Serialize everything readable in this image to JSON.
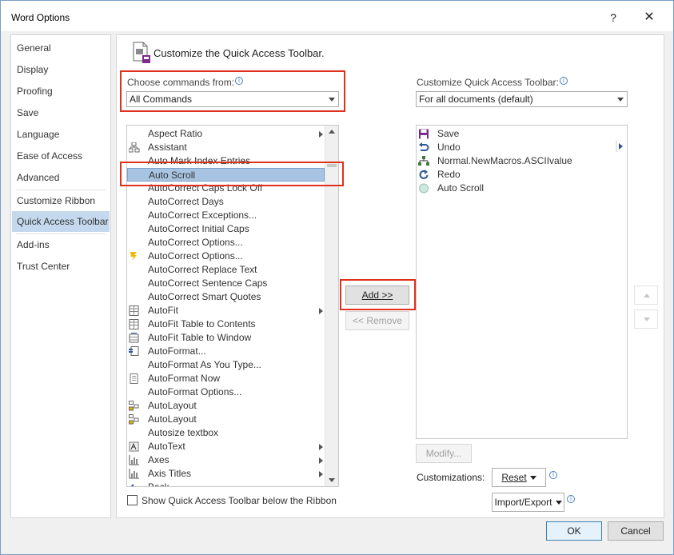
{
  "window": {
    "title": "Word Options",
    "help_label": "?",
    "close_label": "✕"
  },
  "nav": {
    "items": [
      {
        "label": "General"
      },
      {
        "label": "Display"
      },
      {
        "label": "Proofing"
      },
      {
        "label": "Save"
      },
      {
        "label": "Language"
      },
      {
        "label": "Ease of Access"
      },
      {
        "label": "Advanced"
      },
      {
        "label": "Customize Ribbon"
      },
      {
        "label": "Quick Access Toolbar"
      },
      {
        "label": "Add-ins"
      },
      {
        "label": "Trust Center"
      }
    ],
    "active": "Quick Access Toolbar"
  },
  "main": {
    "header": "Customize the Quick Access Toolbar.",
    "choose_label": "Choose commands from:",
    "choose_value": "All Commands",
    "customize_label": "Customize Quick Access Toolbar:",
    "customize_value": "For all documents (default)",
    "info_glyph": "i"
  },
  "commands": [
    {
      "label": "Aspect Ratio",
      "icon": "none",
      "submenu": true
    },
    {
      "label": "Assistant",
      "icon": "org-chart-icon",
      "submenu": false
    },
    {
      "label": "Auto Mark Index Entries",
      "icon": "none",
      "submenu": false
    },
    {
      "label": "Auto Scroll",
      "icon": "none",
      "submenu": false,
      "selected": true
    },
    {
      "label": "AutoCorrect Caps Lock Off",
      "icon": "none",
      "submenu": false
    },
    {
      "label": "AutoCorrect Days",
      "icon": "none",
      "submenu": false
    },
    {
      "label": "AutoCorrect Exceptions...",
      "icon": "none",
      "submenu": false
    },
    {
      "label": "AutoCorrect Initial Caps",
      "icon": "none",
      "submenu": false
    },
    {
      "label": "AutoCorrect Options...",
      "icon": "none",
      "submenu": false
    },
    {
      "label": "AutoCorrect Options...",
      "icon": "lightning-icon",
      "submenu": false
    },
    {
      "label": "AutoCorrect Replace Text",
      "icon": "none",
      "submenu": false
    },
    {
      "label": "AutoCorrect Sentence Caps",
      "icon": "none",
      "submenu": false
    },
    {
      "label": "AutoCorrect Smart Quotes",
      "icon": "none",
      "submenu": false
    },
    {
      "label": "AutoFit",
      "icon": "table-icon",
      "submenu": true
    },
    {
      "label": "AutoFit Table to Contents",
      "icon": "table-icon",
      "submenu": false
    },
    {
      "label": "AutoFit Table to Window",
      "icon": "table-window-icon",
      "submenu": false
    },
    {
      "label": "AutoFormat...",
      "icon": "format-icon",
      "submenu": false
    },
    {
      "label": "AutoFormat As You Type...",
      "icon": "none",
      "submenu": false
    },
    {
      "label": "AutoFormat Now",
      "icon": "document-icon",
      "submenu": false
    },
    {
      "label": "AutoFormat Options...",
      "icon": "none",
      "submenu": false
    },
    {
      "label": "AutoLayout",
      "icon": "layout-icon",
      "submenu": false
    },
    {
      "label": "AutoLayout",
      "icon": "layout-icon",
      "submenu": false
    },
    {
      "label": "Autosize textbox",
      "icon": "none",
      "submenu": false
    },
    {
      "label": "AutoText",
      "icon": "autotext-icon",
      "submenu": true
    },
    {
      "label": "Axes",
      "icon": "chart-axes-icon",
      "submenu": true
    },
    {
      "label": "Axis Titles",
      "icon": "chart-axes-icon",
      "submenu": true
    },
    {
      "label": "Back",
      "icon": "back-arrow-icon",
      "submenu": false
    }
  ],
  "toolbar_items": [
    {
      "label": "Save",
      "icon": "save-icon"
    },
    {
      "label": "Undo",
      "icon": "undo-icon"
    },
    {
      "label": "Normal.NewMacros.ASCIIvalue",
      "icon": "macro-icon"
    },
    {
      "label": "Redo",
      "icon": "redo-icon"
    },
    {
      "label": "Auto Scroll",
      "icon": "circle-icon"
    }
  ],
  "buttons": {
    "add": "Add >>",
    "remove": "<< Remove",
    "modify": "Modify...",
    "reset": "Reset",
    "import_export": "Import/Export",
    "ok": "OK",
    "cancel": "Cancel"
  },
  "customizations_label": "Customizations:",
  "show_below_label": "Show Quick Access Toolbar below the Ribbon",
  "colors": {
    "highlight_red": "#e0301e",
    "nav_active": "#c5d9ee",
    "selected_row": "#a8c4e3"
  }
}
